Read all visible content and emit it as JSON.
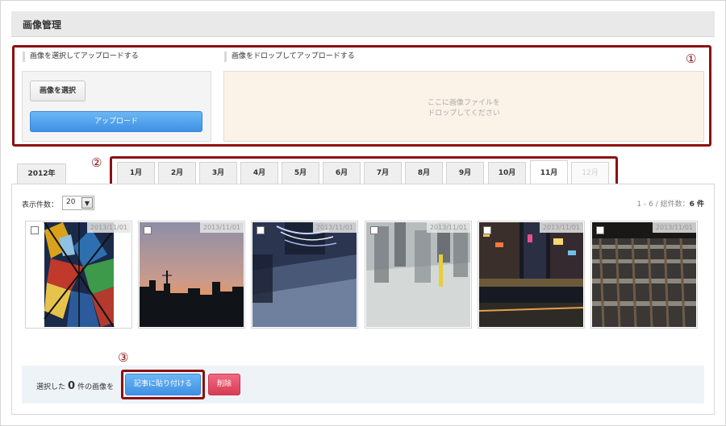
{
  "header": {
    "title": "画像管理"
  },
  "upload": {
    "marker": "①",
    "select_label": "画像を選択してアップロードする",
    "select_button": "画像を選択",
    "upload_button": "アップロード",
    "drop_label": "画像をドロップしてアップロードする",
    "drop_hint_line1": "ここに画像ファイルを",
    "drop_hint_line2": "ドロップしてください"
  },
  "tabs": {
    "marker": "②",
    "year": "2012年",
    "months": [
      "1月",
      "2月",
      "3月",
      "4月",
      "5月",
      "6月",
      "7月",
      "8月",
      "9月",
      "10月",
      "11月",
      "12月"
    ],
    "active_month": "11月",
    "disabled_month": "12月"
  },
  "gallery": {
    "per_page_label": "表示件数：",
    "per_page_value": "20",
    "count_prefix": "1 - 6 / 総件数：",
    "count_total": "6 件",
    "images": [
      {
        "date": "2013/11/01",
        "subject": "stained-glass"
      },
      {
        "date": "2013/11/01",
        "subject": "sunset-skyline"
      },
      {
        "date": "2013/11/01",
        "subject": "night-street-blur"
      },
      {
        "date": "2013/11/01",
        "subject": "crowd-motion-blur"
      },
      {
        "date": "2013/11/01",
        "subject": "city-night-lights"
      },
      {
        "date": "2013/11/01",
        "subject": "railway-tracks"
      }
    ]
  },
  "actions": {
    "marker": "③",
    "selected_prefix": "選択した",
    "selected_count": "0",
    "selected_suffix": "件の画像を",
    "paste_button": "記事に貼り付ける",
    "delete_button": "削除"
  }
}
